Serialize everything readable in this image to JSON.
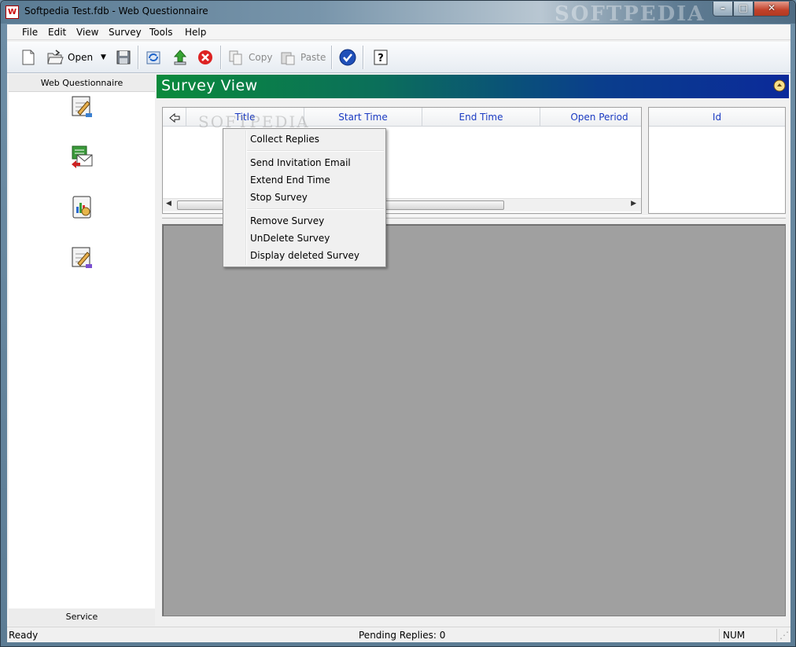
{
  "window": {
    "title": "Softpedia Test.fdb - Web Questionnaire",
    "app_icon_text": "W",
    "watermark": "SOFTPEDIA"
  },
  "menubar": {
    "items": [
      "File",
      "Edit",
      "View",
      "Survey",
      "Tools",
      "Help"
    ]
  },
  "toolbar": {
    "open_label": "Open",
    "copy_label": "Copy",
    "paste_label": "Paste"
  },
  "left_panel": {
    "header": "Web Questionnaire",
    "footer": "Service"
  },
  "banner": {
    "title": "Survey View"
  },
  "grid": {
    "columns": [
      "Title",
      "Start Time",
      "End Time",
      "Open Period"
    ],
    "side_column": "Id",
    "watermark": "SOFTPEDIA"
  },
  "context_menu": {
    "items": [
      "Collect Replies",
      "Send Invitation Email",
      "Extend End Time",
      "Stop Survey",
      "Remove Survey",
      "UnDelete Survey",
      "Display deleted Survey"
    ]
  },
  "statusbar": {
    "left": "Ready",
    "center": "Pending Replies: 0",
    "right": "NUM"
  }
}
